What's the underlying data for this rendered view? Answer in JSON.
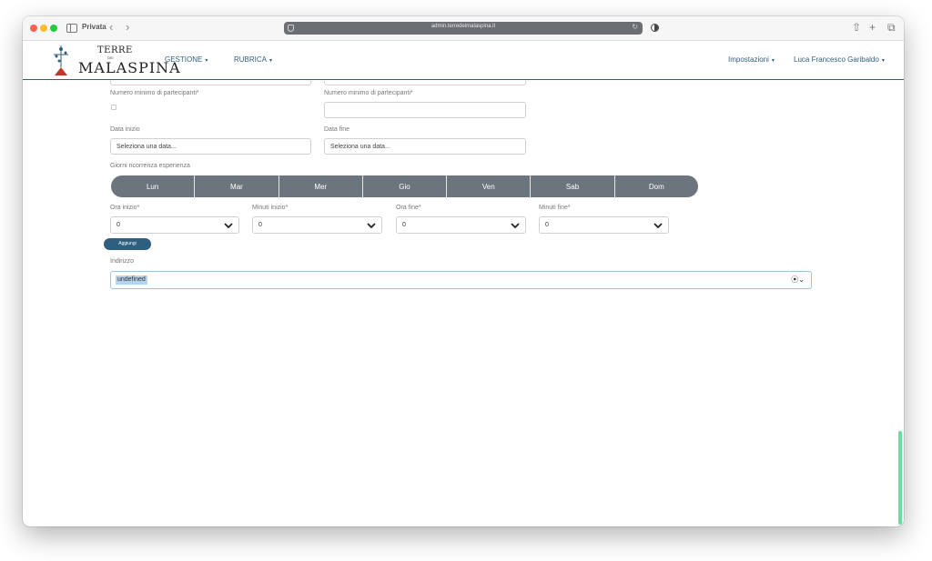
{
  "browser": {
    "private_label": "Privata",
    "url": "admin.terredeimalaspina.it",
    "back_icon": "‹",
    "forward_icon": "›",
    "share_icon": "⇧",
    "new_tab_icon": "+",
    "tabs_icon": "⧉"
  },
  "header": {
    "brand_top": "TERRE",
    "brand_mid": "DEI",
    "brand_main": "MALASPINA",
    "nav": [
      {
        "label": "GESTIONE"
      },
      {
        "label": "RUBRICA"
      }
    ],
    "settings_label": "Impostazioni",
    "user_label": "Luca Francesco Garibaldo",
    "caret": "▾"
  },
  "form": {
    "min_participants_left_label": "Numero minimo di partecipanti*",
    "min_participants_right_label": "Numero minimo di partecipanti*",
    "start_date_label": "Data inizio",
    "start_date_placeholder": "Seleziona una data...",
    "end_date_label": "Data fine",
    "end_date_placeholder": "Seleziona una data...",
    "recurrence_label": "Giorni ricorrenza esperienza",
    "days": [
      "Lun",
      "Mar",
      "Mer",
      "Gio",
      "Ven",
      "Sab",
      "Dom"
    ],
    "ora_inizio_label": "Ora inizio*",
    "ora_inizio_value": "0",
    "minuti_inizio_label": "Minuti inizio*",
    "minuti_inizio_value": "0",
    "ora_fine_label": "Ora fine*",
    "ora_fine_value": "0",
    "minuti_fine_label": "Minuti fine*",
    "minuti_fine_value": "0",
    "add_button": "Aggiungi",
    "address_label": "Indirizzo",
    "address_value": "undefined",
    "address_tools": "⦿⌄"
  },
  "colors": {
    "brand_blue": "#2e5f7e",
    "day_bar": "#6c757d",
    "scroll_thumb": "#6fdba4"
  }
}
